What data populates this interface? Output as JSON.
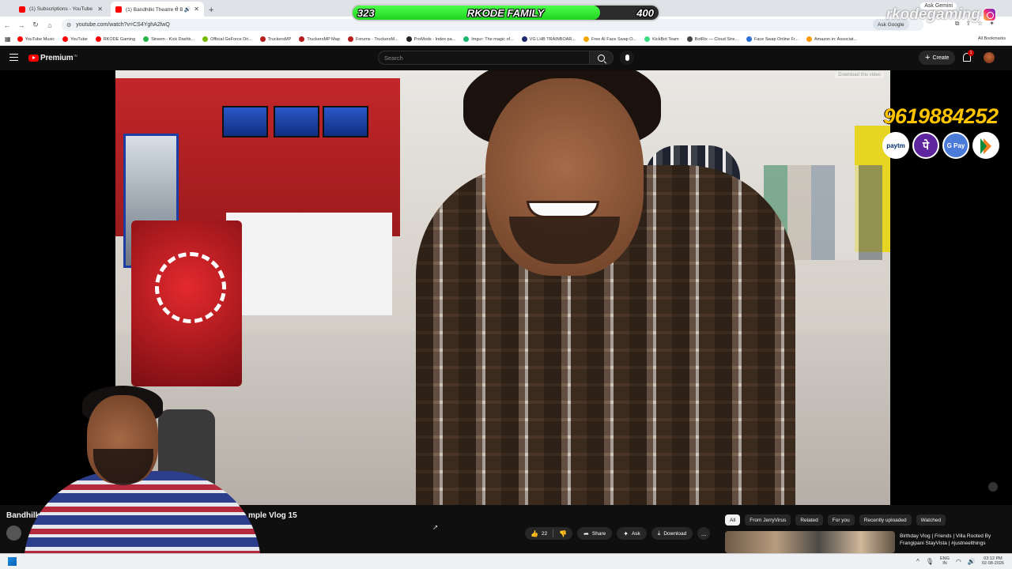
{
  "browser": {
    "tabs": [
      {
        "title": "(1) Subscriptions - YouTube",
        "close": "✕"
      },
      {
        "title": "(1) Bandhilki Theatre से Bhaga...",
        "close": "✕"
      }
    ],
    "new_tab": "+",
    "url": "youtube.com/watch?v=CS4YghA2lwQ",
    "ask_google": "Ask Google",
    "ask_gemini": "Ask Gemini",
    "bookmarks": [
      {
        "label": "YouTube Music",
        "color": "#ff0000"
      },
      {
        "label": "YouTube",
        "color": "#ff0000"
      },
      {
        "label": "RKODE Gaming",
        "color": "#ff0000"
      },
      {
        "label": "Streem - Kick Dashb...",
        "color": "#27b54a"
      },
      {
        "label": "Official GeForce Dri...",
        "color": "#76b900"
      },
      {
        "label": "TruckersMP",
        "color": "#b71c1c"
      },
      {
        "label": "TruckersMP Map",
        "color": "#b71c1c"
      },
      {
        "label": "Forums - TruckersM...",
        "color": "#b71c1c"
      },
      {
        "label": "ProMods - Index pa...",
        "color": "#222222"
      },
      {
        "label": "Imgur: The magic of...",
        "color": "#1bb76e"
      },
      {
        "label": "VG LHB TRAINBOAR...",
        "color": "#1f2a6b"
      },
      {
        "label": "Free AI Face Swap O...",
        "color": "#f2a700"
      },
      {
        "label": "KickBot Team",
        "color": "#3ddc84"
      },
      {
        "label": "BotRix — Cloud Stre...",
        "color": "#444444"
      },
      {
        "label": "Face Swap Online Fr...",
        "color": "#2b6fd6"
      },
      {
        "label": "Amazon.in: Associat...",
        "color": "#ff9900"
      }
    ],
    "all_bookmarks": "All Bookmarks"
  },
  "overlay": {
    "goal_current": "323",
    "goal_label": "RKODE FAMILY",
    "goal_max": "400",
    "goal_progress": 0.8075,
    "brand": "rkodegaming",
    "donation_number": "9619884252",
    "payments": [
      "paytm",
      "पे",
      "G Pay",
      ""
    ]
  },
  "youtube": {
    "logo_text": "Premium",
    "logo_badge": "IN",
    "search_placeholder": "Search",
    "create_label": "Create",
    "notification_count": "1",
    "player_hint": "Download this video",
    "video_title_start": "Bandhilki",
    "video_title_end": "mple Vlog 15",
    "likes": "22",
    "share_label": "Share",
    "ask_label": "Ask",
    "download_label": "Download",
    "more": "...",
    "chips": [
      "All",
      "From JerryVirus",
      "Related",
      "For you",
      "Recently uploaded",
      "Watched"
    ],
    "recommendation_title": "Birthday Vlog | Friends | Villa Rooted By Frangipani StayVista | #justneelthings"
  },
  "taskbar": {
    "lang_top": "ENG",
    "lang_bottom": "IN",
    "time": "03:12 PM",
    "date": "02-08-2026"
  }
}
